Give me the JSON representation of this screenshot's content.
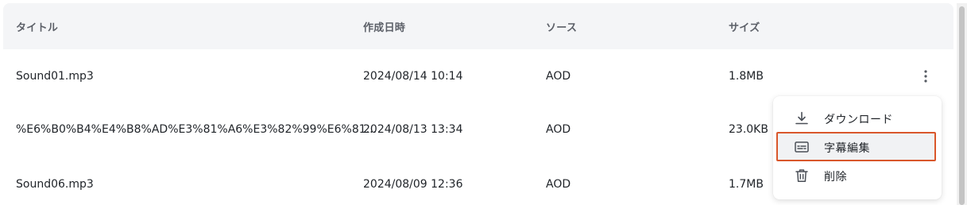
{
  "table": {
    "columns": [
      "タイトル",
      "作成日時",
      "ソース",
      "サイズ"
    ],
    "rows": [
      {
        "title": "Sound01.mp3",
        "created": "2024/08/14 10:14",
        "source": "AOD",
        "size": "1.8MB"
      },
      {
        "title": "%E6%B0%B4%E4%B8%AD%E3%81%A6%E3%82%99%E6%81...",
        "created": "2024/08/13 13:34",
        "source": "AOD",
        "size": "23.0KB"
      },
      {
        "title": "Sound06.mp3",
        "created": "2024/08/09 12:36",
        "source": "AOD",
        "size": "1.7MB"
      }
    ]
  },
  "row_menu": {
    "icon": "more-vertical-icon",
    "items": [
      {
        "label": "ダウンロード",
        "icon": "download-icon"
      },
      {
        "label": "字幕編集",
        "icon": "subtitles-icon",
        "highlighted": true
      },
      {
        "label": "削除",
        "icon": "trash-icon"
      }
    ]
  },
  "colors": {
    "header_bg": "#f4f5f7",
    "highlight_border": "#d9572b",
    "text": "#1f2328",
    "header_text": "#5c6068"
  }
}
